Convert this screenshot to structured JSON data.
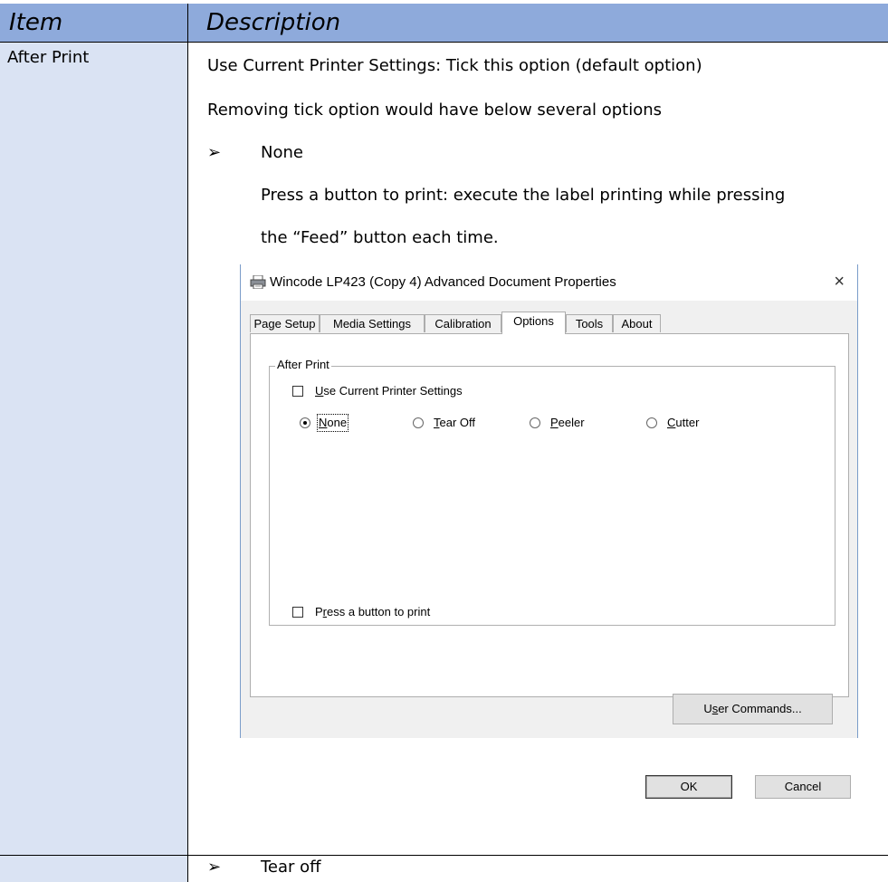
{
  "table": {
    "headers": {
      "item": "Item",
      "description": "Description"
    },
    "row1": {
      "item": "After Print",
      "line1": "Use Current Printer Settings: Tick this option (default option)",
      "line2": "Removing tick option would have    below several options",
      "bullet1": "None",
      "line3": "Press a button to print: execute the label printing while pressing",
      "line4": "the “Feed” button each time."
    },
    "row2": {
      "bullet": "Tear off"
    }
  },
  "dialog": {
    "title": "Wincode LP423 (Copy 4) Advanced Document Properties",
    "close": "×",
    "tabs": [
      "Page Setup",
      "Media Settings",
      "Calibration",
      "Options",
      "Tools",
      "About"
    ],
    "active_tab": "Options",
    "group_label": "After Print",
    "use_current": {
      "label": "Use Current Printer Settings",
      "checked": false
    },
    "radios": [
      {
        "label": "None",
        "selected": true
      },
      {
        "label": "Tear Off",
        "selected": false
      },
      {
        "label": "Peeler",
        "selected": false
      },
      {
        "label": "Cutter",
        "selected": false
      }
    ],
    "press_button": {
      "label": "Press a button to print",
      "checked": false
    },
    "user_commands": "User Commands...",
    "ok": "OK",
    "cancel": "Cancel"
  },
  "icons": {
    "bullet": "arrow-bullet-icon",
    "printer": "printer-icon",
    "close": "close-icon"
  },
  "colors": {
    "header": "#8eaadb",
    "item_column": "#dae3f3",
    "dialog_bg": "#f0f0f0"
  }
}
